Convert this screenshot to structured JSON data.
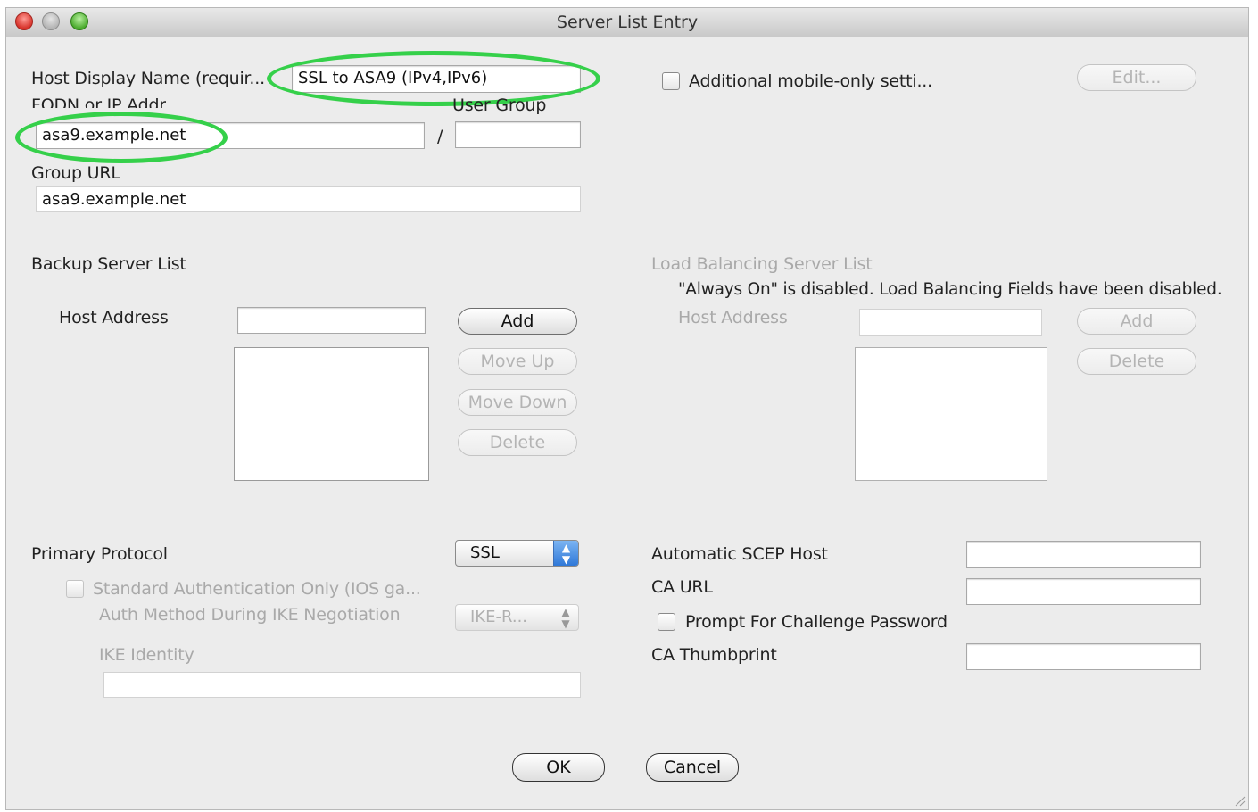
{
  "window": {
    "title": "Server List Entry"
  },
  "host": {
    "display_name_label": "Host Display Name (requir...",
    "display_name_value": "SSL to ASA9 (IPv4,IPv6)",
    "fqdn_label": "FQDN or IP Addr",
    "fqdn_value": "asa9.example.net",
    "separator": "/",
    "user_group_label": "User Group",
    "user_group_value": ""
  },
  "group_url": {
    "label": "Group URL",
    "value": "asa9.example.net"
  },
  "mobile": {
    "checkbox_label": "Additional mobile-only setti...",
    "edit_button": "Edit..."
  },
  "backup": {
    "title": "Backup Server List",
    "host_address_label": "Host Address",
    "buttons": {
      "add": "Add",
      "move_up": "Move Up",
      "move_down": "Move Down",
      "delete": "Delete"
    }
  },
  "load_balancing": {
    "title": "Load Balancing Server List",
    "notice": "\"Always On\" is disabled.  Load Balancing Fields have been disabled.",
    "host_address_label": "Host Address",
    "buttons": {
      "add": "Add",
      "delete": "Delete"
    }
  },
  "protocol": {
    "label": "Primary Protocol",
    "value": "SSL",
    "std_auth_label": "Standard Authentication Only (IOS ga...",
    "auth_method_label": "Auth Method During IKE Negotiation",
    "auth_method_value": "IKE-R...",
    "ike_identity_label": "IKE Identity",
    "ike_identity_value": ""
  },
  "scep": {
    "auto_host_label": "Automatic SCEP Host",
    "ca_url_label": "CA URL",
    "prompt_label": "Prompt For Challenge Password",
    "thumbprint_label": "CA Thumbprint"
  },
  "footer": {
    "ok": "OK",
    "cancel": "Cancel"
  },
  "colors": {
    "highlight_ring": "#35d04a",
    "popup_accent": "#2f78d8"
  }
}
